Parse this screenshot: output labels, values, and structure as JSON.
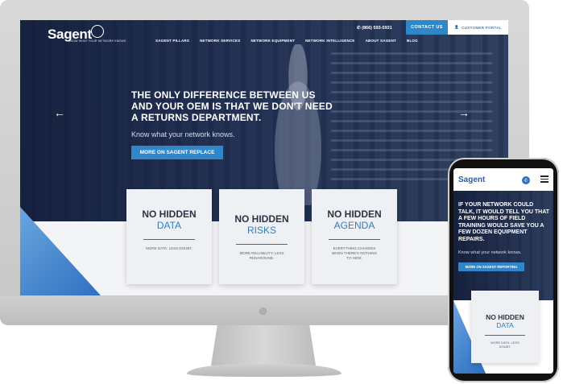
{
  "brand": {
    "logo": "Sagent",
    "tagline": "KNOW WHAT YOUR NETWORK KNOWS"
  },
  "nav": [
    {
      "label": "SAGENT PILLARS"
    },
    {
      "label": "NETWORK SERVICES"
    },
    {
      "label": "NETWORK EQUIPMENT"
    },
    {
      "label": "NETWORK INTELLIGENCE"
    },
    {
      "label": "ABOUT SAGENT"
    },
    {
      "label": "BLOG"
    }
  ],
  "header": {
    "phone": "(866) 593-5931",
    "contact_label": "CONTACT US",
    "portal_label": "CUSTOMER PORTAL"
  },
  "hero": {
    "headline": "THE ONLY DIFFERENCE BETWEEN US AND YOUR OEM IS THAT WE DON'T NEED A RETURNS DEPARTMENT.",
    "subline": "Know what your network knows.",
    "button_label": "MORE ON SAGENT REPLACE",
    "prev_arrow": "←",
    "next_arrow": "→"
  },
  "cards": [
    {
      "title": "NO HIDDEN",
      "accent": "DATA",
      "text": "MORE DATA. LESS DOUBT."
    },
    {
      "title": "NO HIDDEN",
      "accent": "RISKS",
      "text": "MORE RELIABILITY. LESS RUNAROUND."
    },
    {
      "title": "NO HIDDEN",
      "accent": "AGENDA",
      "text": "EVERYTHING CHANGES WHEN THERE'S NOTHING TO HIDE."
    }
  ],
  "mobile": {
    "logo": "Sagent",
    "phone_icon": "✆",
    "headline": "IF YOUR NETWORK COULD TALK, IT WOULD TELL YOU THAT A FEW HOURS OF FIELD TRAINING WOULD SAVE YOU A FEW DOZEN EQUIPMENT REPAIRS.",
    "subline": "Know what your network knows.",
    "button_label": "MORE ON SAGENT REPORTING",
    "card": {
      "title": "NO HIDDEN",
      "accent": "DATA",
      "text": "MORE DATA. LESS DOUBT."
    }
  },
  "colors": {
    "accent": "#2f87c9",
    "navy": "#1e2a48",
    "card_bg": "#eef0f3"
  }
}
